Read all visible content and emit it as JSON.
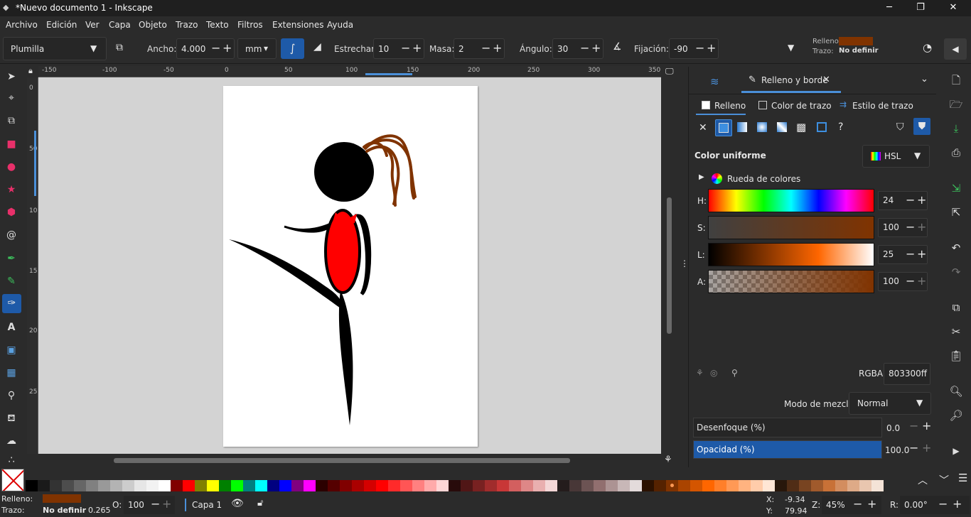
{
  "window": {
    "title": "*Nuevo documento 1 - Inkscape",
    "min": "─",
    "max": "❐",
    "close": "✕"
  },
  "menu": [
    "Archivo",
    "Edición",
    "Ver",
    "Capa",
    "Objeto",
    "Trazo",
    "Texto",
    "Filtros",
    "Extensiones",
    "Ayuda"
  ],
  "toolcontrols": {
    "preset": "Plumilla",
    "width_label": "Ancho:",
    "width_value": "4.000",
    "unit": "mm",
    "thinning_label": "Estrechar:",
    "thinning_value": "10",
    "mass_label": "Masa:",
    "mass_value": "2",
    "angle_label": "Ángulo:",
    "angle_value": "30",
    "fixation_label": "Fijación:",
    "fixation_value": "-90",
    "fill_label": "Relleno:",
    "stroke_label": "Trazo:",
    "stroke_value": "No definir"
  },
  "ruler_top": [
    "-150",
    "-100",
    "-50",
    "0",
    "50",
    "100",
    "150",
    "200",
    "250",
    "300",
    "350"
  ],
  "ruler_left": [
    "0",
    "50",
    "100",
    "150",
    "200",
    "250"
  ],
  "dock": {
    "tab_title": "Relleno y borde",
    "subtabs": [
      "Relleno",
      "Color de trazo",
      "Estilo de trazo"
    ],
    "paint_unknown": "?",
    "color_mode_title": "Color uniforme",
    "color_mode": "HSL",
    "wheel_label": "Rueda de colores",
    "channels": [
      {
        "label": "H:",
        "value": "24"
      },
      {
        "label": "S:",
        "value": "100"
      },
      {
        "label": "L:",
        "value": "25"
      },
      {
        "label": "A:",
        "value": "100"
      }
    ],
    "rgba_label": "RGBA:",
    "rgba_value": "803300ff",
    "blend_label": "Modo de mezcla:",
    "blend_value": "Normal",
    "blur_label": "Desenfoque (%)",
    "blur_value": "0.0",
    "opacity_label": "Opacidad (%)",
    "opacity_value": "100.0"
  },
  "status": {
    "fill_label": "Relleno:",
    "stroke_label": "Trazo:",
    "stroke_value": "No definir",
    "stroke_width": "0.265",
    "opacity_label": "O:",
    "opacity_value": "100",
    "layer": "Capa 1",
    "x_label": "X:",
    "x_value": "-9.34",
    "y_label": "Y:",
    "y_value": "79.94",
    "zoom_label": "Z:",
    "zoom_value": "45%",
    "rot_label": "R:",
    "rot_value": "0.00°"
  },
  "colors": {
    "accent": "#1e5aa8",
    "current_fill": "#803300",
    "hair": "#803300"
  },
  "swatches": [
    "#000000",
    "#1a1a1a",
    "#333333",
    "#4d4d4d",
    "#666666",
    "#808080",
    "#999999",
    "#b3b3b3",
    "#cccccc",
    "#e6e6e6",
    "#f2f2f2",
    "#ffffff",
    "#800000",
    "#ff0000",
    "#808000",
    "#ffff00",
    "#008000",
    "#00ff00",
    "#008080",
    "#00ffff",
    "#000080",
    "#0000ff",
    "#800080",
    "#ff00ff",
    "#2b0000",
    "#550000",
    "#800000",
    "#aa0000",
    "#d40000",
    "#ff0000",
    "#ff2a2a",
    "#ff5555",
    "#ff8080",
    "#ffaaaa",
    "#ffd5d5",
    "#280b0b",
    "#501616",
    "#782121",
    "#a02c2c",
    "#c83737",
    "#d35f5f",
    "#de8787",
    "#e9afaf",
    "#f4d7d7",
    "#241c1c",
    "#483737",
    "#6c5353",
    "#916f6f",
    "#ac9393",
    "#c8b7b7",
    "#e3dbdb",
    "#2b1100",
    "#552200",
    "#803300",
    "#aa4400",
    "#d45500",
    "#ff6600",
    "#ff7f2a",
    "#ff9955",
    "#ffb380",
    "#ffccaa",
    "#ffe6d5",
    "#28170b",
    "#502d16",
    "#784421",
    "#a05a2c",
    "#c87137",
    "#d38d5f",
    "#deaa87",
    "#e9c6af",
    "#f4e3d7"
  ]
}
